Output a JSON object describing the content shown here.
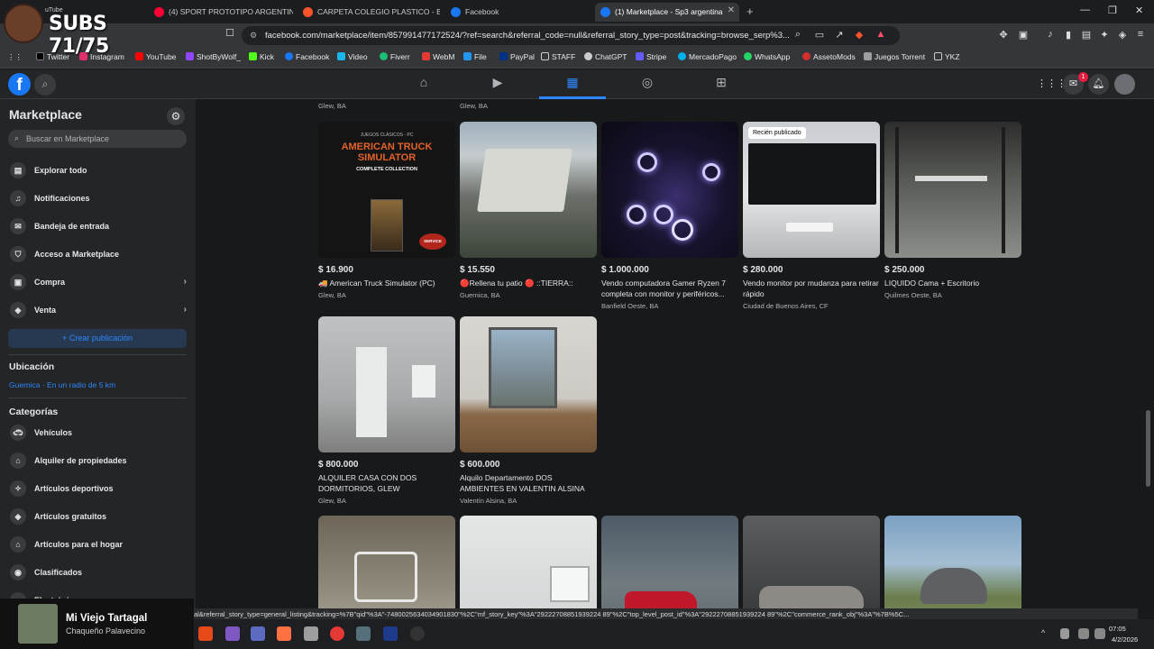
{
  "overlay": {
    "subs": "SUBS 71/75",
    "yt_label": "uTube"
  },
  "tabs": [
    {
      "label": "(4) SPORT PROTOTIPO ARGENTINO: L",
      "color": "#ff0033"
    },
    {
      "label": "CARPETA COLEGIO PLASTICO - Brave",
      "color": "#fb542b"
    },
    {
      "label": "Facebook",
      "color": "#1877f2"
    },
    {
      "label": "(1) Marketplace - Sp3 argentina",
      "color": "#1877f2"
    }
  ],
  "address": "facebook.com/marketplace/item/857991477172524/?ref=search&referral_code=null&referral_story_type=post&tracking=browse_serp%3...",
  "bookmarks": [
    {
      "label": "Twitter",
      "color": "#000000"
    },
    {
      "label": "Instagram",
      "color": "#e1306c"
    },
    {
      "label": "YouTube",
      "color": "#ff0000"
    },
    {
      "label": "ShotByWolf_",
      "color": "#9146ff"
    },
    {
      "label": "Kick",
      "color": "#53fc18"
    },
    {
      "label": "Facebook",
      "color": "#1877f2"
    },
    {
      "label": "Video",
      "color": "#1ab7ea"
    },
    {
      "label": "Fiverr",
      "color": "#1dbf73"
    },
    {
      "label": "WebM",
      "color": "#e53935"
    },
    {
      "label": "File",
      "color": "#2196f3"
    },
    {
      "label": "PayPal",
      "color": "#003087"
    },
    {
      "label": "STAFF",
      "color": "#888888"
    },
    {
      "label": "ChatGPT",
      "color": "#cccccc"
    },
    {
      "label": "Stripe",
      "color": "#635bff"
    },
    {
      "label": "MercadoPago",
      "color": "#00b1ea"
    },
    {
      "label": "WhatsApp",
      "color": "#25d366"
    },
    {
      "label": "AssetoMods",
      "color": "#d32f2f"
    },
    {
      "label": "Juegos Torrent",
      "color": "#9e9e9e"
    },
    {
      "label": "YKZ",
      "color": "#888888"
    }
  ],
  "fb": {
    "notif_count": "1",
    "logo": "f"
  },
  "sidebar": {
    "title": "Marketplace",
    "search_placeholder": "Buscar en Marketplace",
    "items": [
      {
        "label": "Explorar todo"
      },
      {
        "label": "Notificaciones"
      },
      {
        "label": "Bandeja de entrada"
      },
      {
        "label": "Acceso a Marketplace"
      },
      {
        "label": "Compra"
      },
      {
        "label": "Venta"
      }
    ],
    "create_label": "+ Crear publicación",
    "location_heading": "Ubicación",
    "location_value": "Guernica · En un radio de 5 km",
    "categories_heading": "Categorías",
    "categories": [
      {
        "label": "Vehículos"
      },
      {
        "label": "Alquiler de propiedades"
      },
      {
        "label": "Artículos deportivos"
      },
      {
        "label": "Artículos gratuitos"
      },
      {
        "label": "Artículos para el hogar"
      },
      {
        "label": "Clasificados"
      },
      {
        "label": "Electrónica"
      }
    ]
  },
  "top_locations": [
    "Glew, BA",
    "Glew, BA"
  ],
  "listings_row1": [
    {
      "price": "$ 16.900",
      "title": "🚚 American Truck Simulator (PC)",
      "location": "Glew, BA"
    },
    {
      "price": "$ 15.550",
      "title": "🔴Rellena tu patio 🔴 ::TIERRA::",
      "location": "Guernica, BA"
    },
    {
      "price": "$ 1.000.000",
      "title": "Vendo computadora Gamer Ryzen 7 completa con monitor y periféricos...",
      "location": "Banfield Oeste, BA"
    },
    {
      "price": "$ 280.000",
      "title": "Vendo monitor por mudanza para retirar rápido",
      "location": "Ciudad de Buenos Aires, CF",
      "badge": "Recién publicado"
    },
    {
      "price": "$ 250.000",
      "title": "LIQUIDO Cama + Escritorio",
      "location": "Quilmes Oeste, BA"
    }
  ],
  "listings_row2": [
    {
      "price": "$ 800.000",
      "title": "ALQUILER CASA CON DOS DORMITORIOS, GLEW",
      "location": "Glew, BA"
    },
    {
      "price": "$ 600.000",
      "title": "Alquilo Departamento DOS AMBIENTES EN VALENTIN ALSINA",
      "location": "Valentín Alsina, BA"
    }
  ],
  "ats_cover": {
    "kicker": "JUEGOS CLÁSICOS - PC",
    "title_line1": "AMERICAN TRUCK",
    "title_line2": "SIMULATOR",
    "subtitle": "COMPLETE COLLECTION",
    "badge": "SERVICE"
  },
  "status_url": "...4791/?ref=product_details&referral_code=marketplace_general&referral_story_type=general_listing&tracking=%7B\"qid\"%3A\"-7480025634034901830\"%2C\"mf_story_key\"%3A\"29222708851939224 89\"%2C\"top_level_post_id\"%3A\"29222708851939224 89\"%2C\"commerce_rank_obj\"%3A\"%7B%5C...",
  "music": {
    "song": "Mi Viejo Tartagal",
    "artist": "Chaqueño Palavecino"
  },
  "clock": {
    "time": "07:05",
    "date": "4/2/2026"
  }
}
